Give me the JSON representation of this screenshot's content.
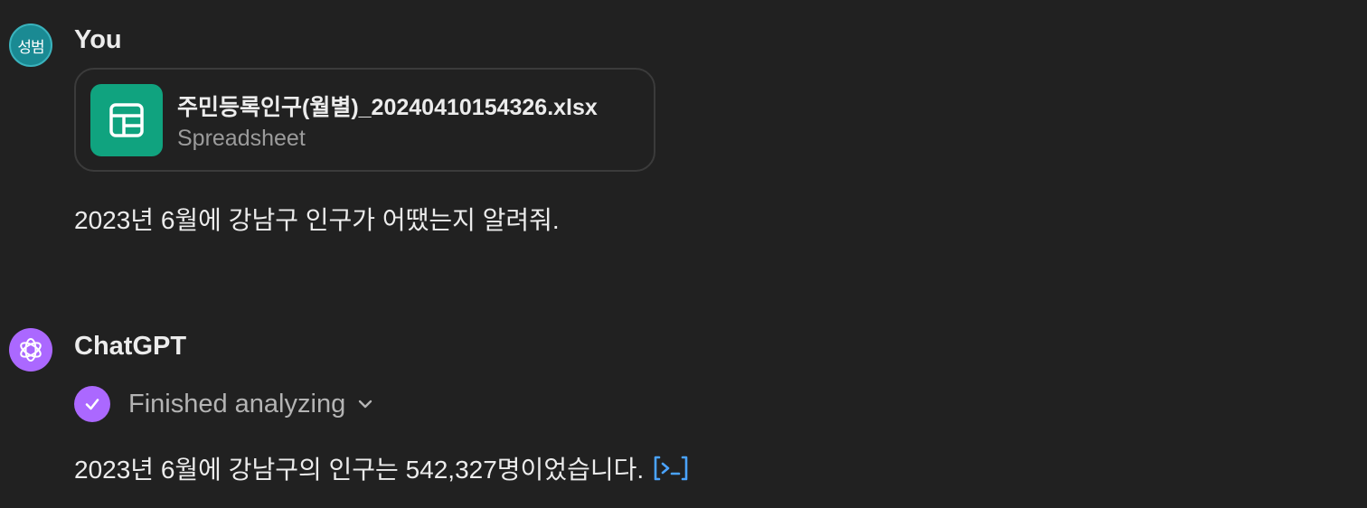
{
  "user_message": {
    "avatar_initials": "성범",
    "author": "You",
    "attachment": {
      "icon": "spreadsheet-icon",
      "file_name": "주민등록인구(월별)_20240410154326.xlsx",
      "file_type": "Spreadsheet"
    },
    "text": "2023년 6월에 강남구 인구가 어땠는지 알려줘."
  },
  "assistant_message": {
    "avatar_icon": "openai-logo-icon",
    "author": "ChatGPT",
    "status": {
      "icon": "check-icon",
      "label": "Finished analyzing",
      "toggle_icon": "chevron-down-icon"
    },
    "text": "2023년 6월에 강남구의 인구는 542,327명이었습니다.",
    "code_link_icon": "code-output-icon"
  },
  "colors": {
    "background": "#212121",
    "user_avatar": "#1a8a93",
    "assistant_avatar": "#ab68ff",
    "spreadsheet_icon_bg": "#10a37f",
    "code_link": "#4aa3ff"
  }
}
